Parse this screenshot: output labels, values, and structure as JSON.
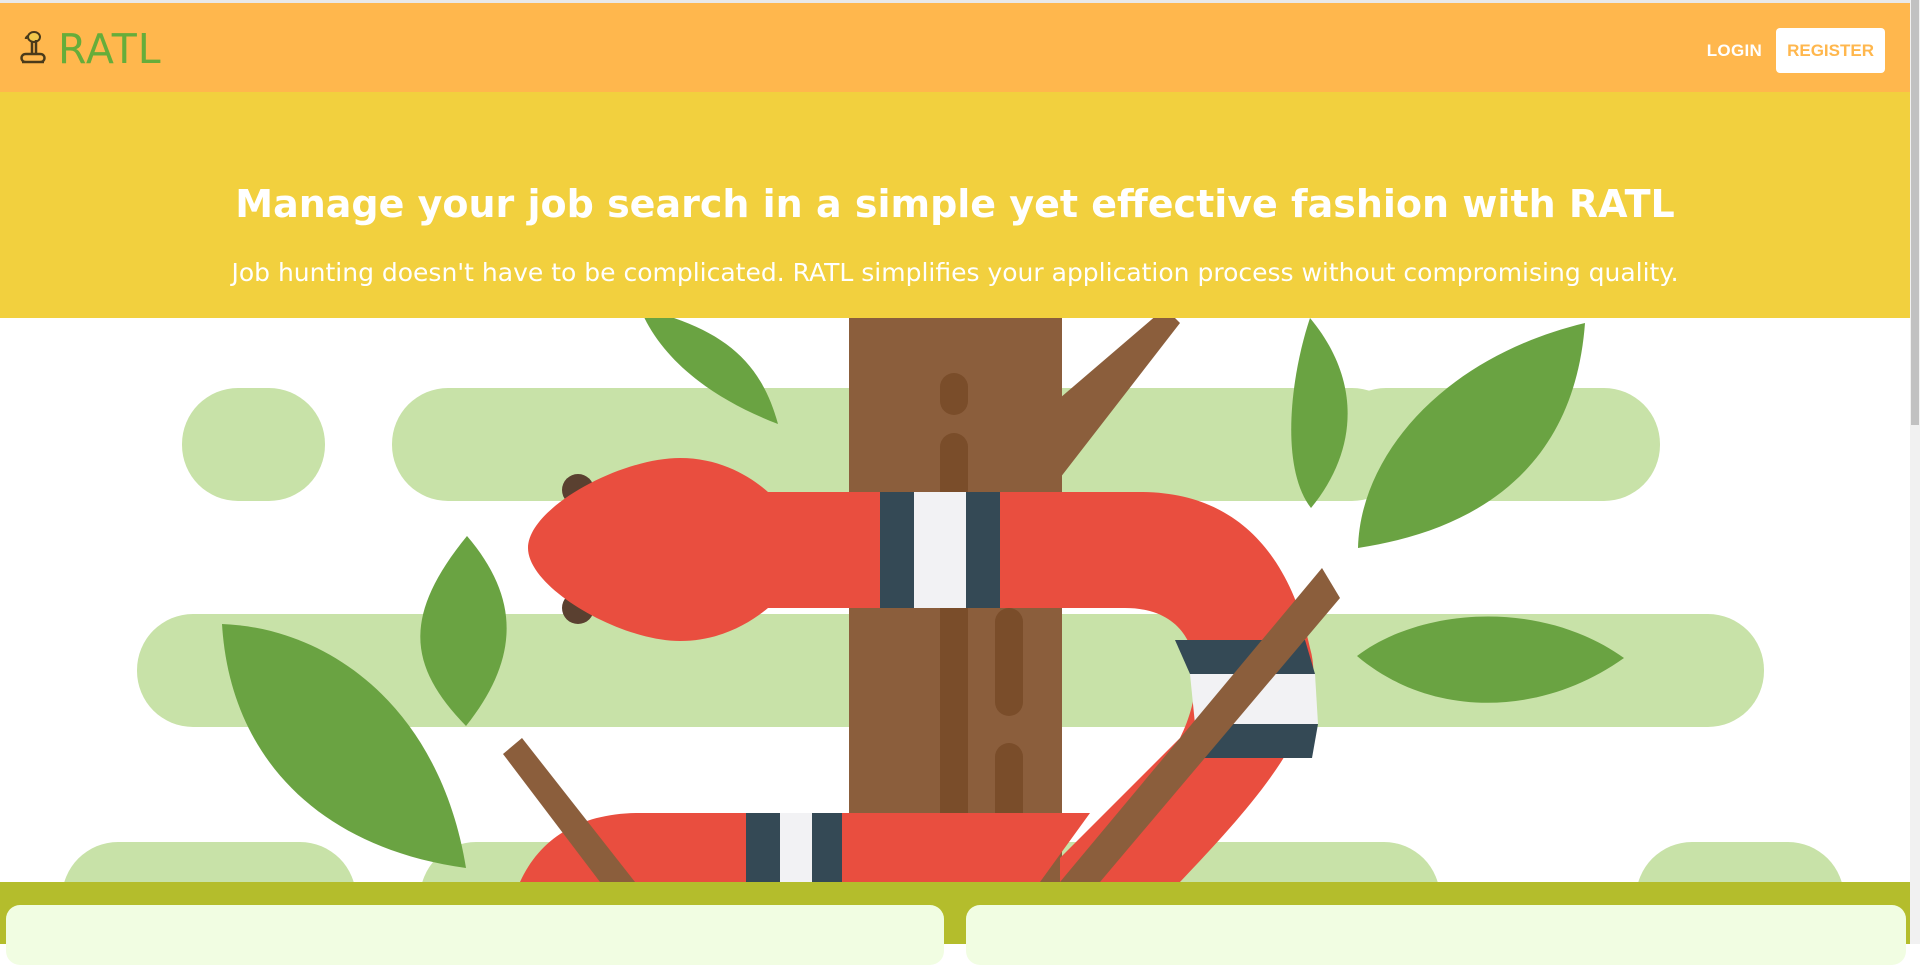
{
  "navbar": {
    "brand": "RATL",
    "brand_icon": "snake-icon",
    "login_label": "LOGIN",
    "register_label": "REGISTER",
    "colors": {
      "background": "#ffb74d",
      "brand": "#66ad3a"
    }
  },
  "hero": {
    "title": "Manage your job search in a simple yet effective fashion with RATL",
    "subtitle": "Job hunting doesn't have to be complicated. RATL simplifies your application process without compromising quality.",
    "colors": {
      "background": "#f2d03e"
    }
  },
  "illustration": {
    "subject": "snake-on-tree-illustration",
    "colors": {
      "leaf": "#6aa342",
      "cloud": "#c8e2a8",
      "trunk": "#8b5e3c",
      "snake": "#e94e3f"
    }
  },
  "band": {
    "colors": {
      "background": "#b4bd2c",
      "card": "#f1fde2"
    }
  }
}
